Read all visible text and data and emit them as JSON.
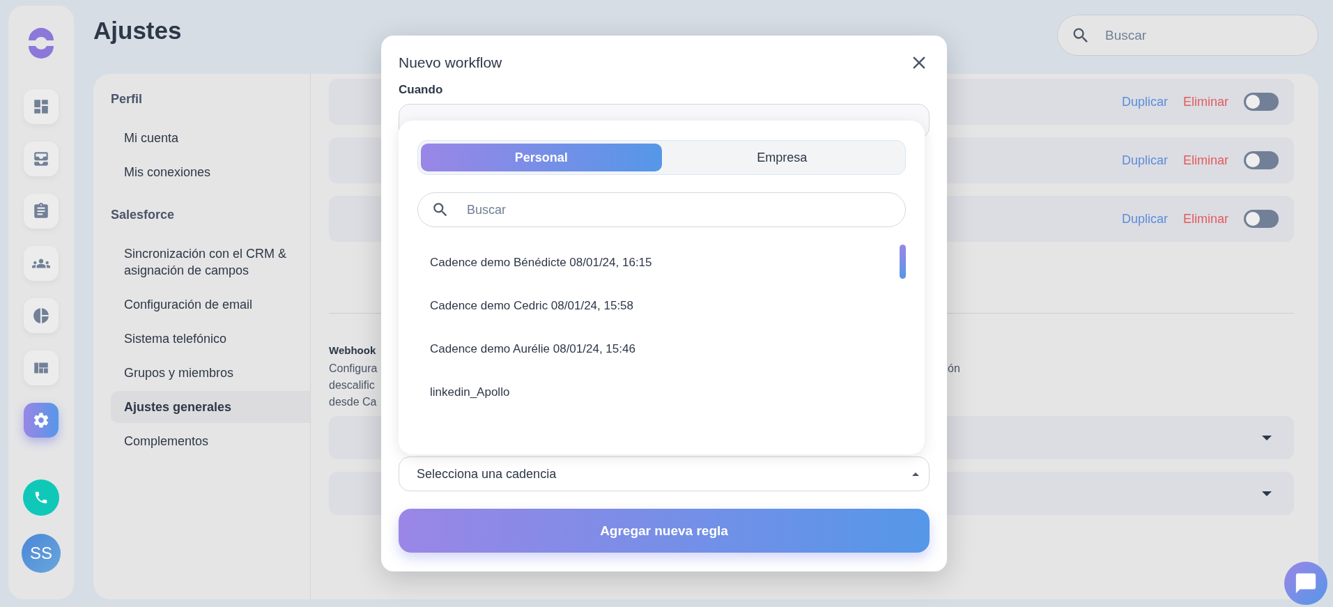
{
  "rail": {
    "items": [
      {
        "selected": false
      },
      {
        "selected": false
      },
      {
        "selected": false
      },
      {
        "selected": false
      },
      {
        "selected": false
      },
      {
        "selected": false
      },
      {
        "selected": true
      }
    ],
    "avatar": "SS"
  },
  "page_title": "Ajustes",
  "search": {
    "placeholder": "Buscar"
  },
  "settings_nav": {
    "sections": [
      {
        "title": "Perfil",
        "items": [
          {
            "label": "Mi cuenta",
            "selected": false
          },
          {
            "label": "Mis conexiones",
            "selected": false
          }
        ]
      },
      {
        "title": "Salesforce",
        "items": [
          {
            "label": "Sincronización con el CRM & asignación de campos",
            "selected": false
          },
          {
            "label": "Configuración de email",
            "selected": false
          },
          {
            "label": "Sistema telefónico",
            "selected": false
          },
          {
            "label": "Grupos y miembros",
            "selected": false
          },
          {
            "label": "Ajustes generales",
            "selected": true
          },
          {
            "label": "Complementos",
            "selected": false
          }
        ]
      }
    ]
  },
  "workflows": [
    {
      "duplicate": "Duplicar",
      "delete": "Eliminar",
      "on": false
    },
    {
      "duplicate": "Duplicar",
      "delete": "Eliminar",
      "on": false
    },
    {
      "duplicate": "Duplicar",
      "delete": "Eliminar",
      "on": false
    }
  ],
  "webhook": {
    "title": "Webhook",
    "description_lines": [
      "Configura",
      "descalific",
      "desde Ca"
    ],
    "tail": "ón"
  },
  "selects": [
    {
      "expanded": false
    },
    {
      "expanded": false
    }
  ],
  "modal": {
    "title": "Nuevo workflow",
    "when_label": "Cuando",
    "tabs": [
      {
        "label": "Personal",
        "selected": true
      },
      {
        "label": "Empresa",
        "selected": false
      }
    ],
    "search": {
      "placeholder": "Buscar"
    },
    "options": [
      "Cadence demo Bénédicte 08/01/24, 16:15",
      "Cadence demo Cedric 08/01/24, 15:58",
      "Cadence demo Aurélie 08/01/24, 15:46",
      "linkedin_Apollo"
    ],
    "cadence_select": {
      "placeholder": "Selecciona una cadencia",
      "expanded": true
    },
    "submit": "Agregar nueva regla"
  }
}
